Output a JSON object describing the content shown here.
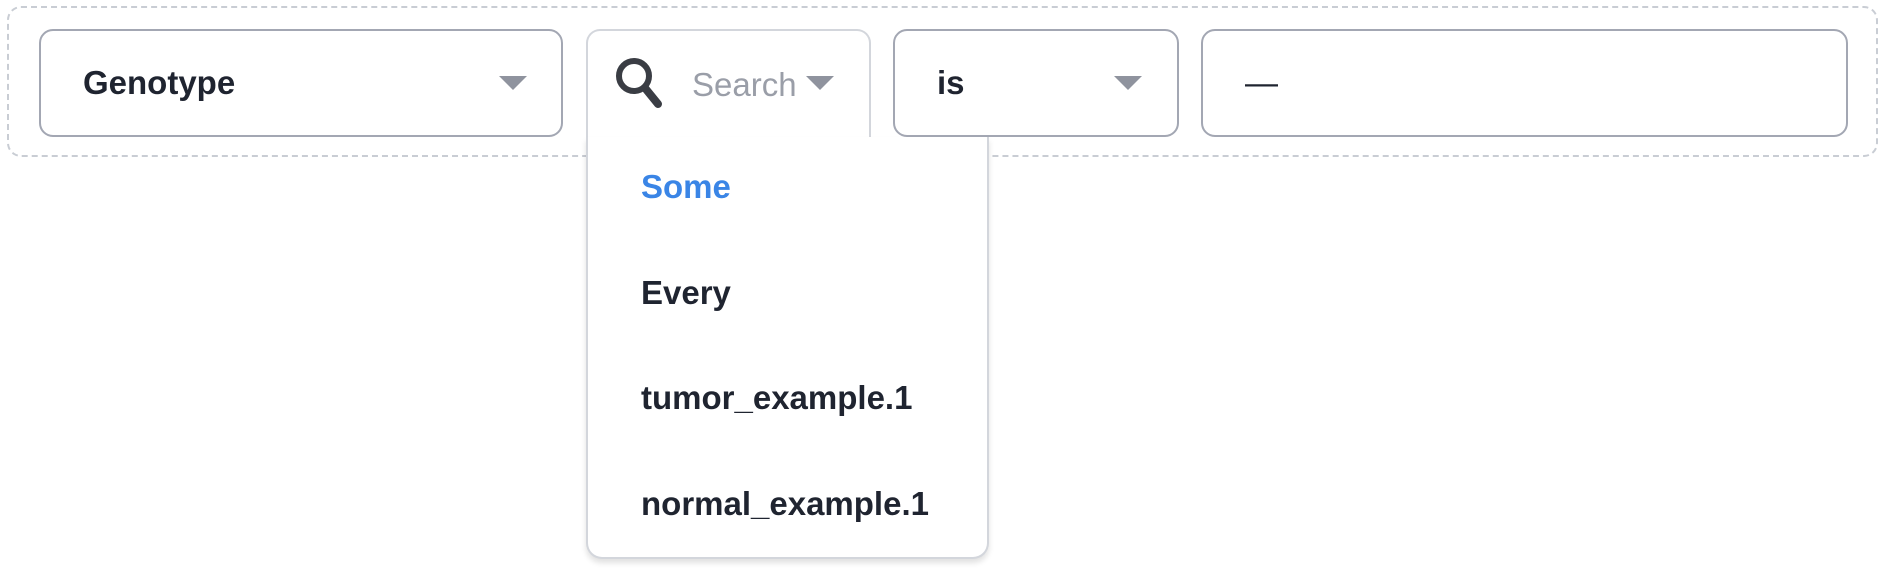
{
  "filter": {
    "field_value": "Genotype",
    "search_placeholder": "Search",
    "operator_value": "is",
    "value_text": "—"
  },
  "dropdown": {
    "items": [
      {
        "label": "Some",
        "selected": true
      },
      {
        "label": "Every",
        "selected": false
      },
      {
        "label": "tumor_example.1",
        "selected": false
      },
      {
        "label": "normal_example.1",
        "selected": false
      }
    ]
  },
  "colors": {
    "accent": "#3a85e6",
    "text": "#1f2430",
    "placeholder": "#9a9ea8",
    "border": "#a3a7b3"
  },
  "icons": [
    "search-icon",
    "caret-down-icon"
  ]
}
